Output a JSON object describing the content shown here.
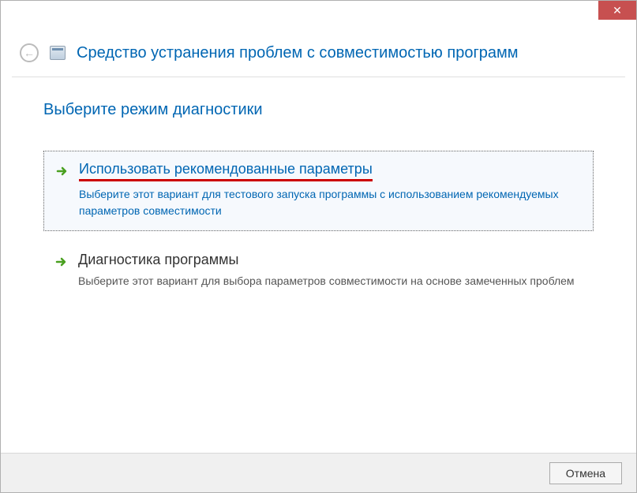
{
  "header": {
    "title": "Средство устранения проблем с совместимостью программ"
  },
  "content": {
    "subtitle": "Выберите режим диагностики",
    "options": [
      {
        "title": "Использовать рекомендованные параметры",
        "description": "Выберите этот вариант для тестового запуска программы с использованием рекомендуемых параметров совместимости"
      },
      {
        "title": "Диагностика программы",
        "description": "Выберите этот вариант для выбора параметров совместимости на основе замеченных проблем"
      }
    ]
  },
  "footer": {
    "cancel_label": "Отмена"
  }
}
